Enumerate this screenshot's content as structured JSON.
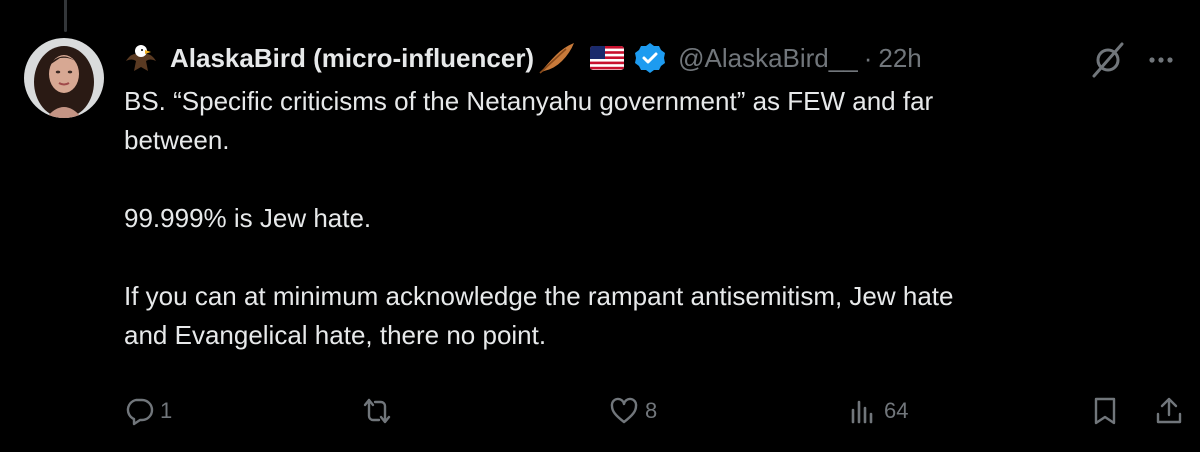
{
  "author": {
    "display_name": "AlaskaBird (micro-influencer)",
    "handle": "@AlaskaBird__",
    "separator": "·",
    "time": "22h",
    "verified": true
  },
  "tweet": {
    "text": "BS. “Specific criticisms of the Netanyahu government” as FEW and far\nbetween.\n\n99.999% is Jew hate.\n\nIf you can at minimum acknowledge the rampant antisemitism, Jew hate\nand Evangelical hate, there no point."
  },
  "actions": {
    "replies": "1",
    "reposts": "",
    "likes": "8",
    "views": "64"
  },
  "icons": {
    "header": [
      "eagle-emoji-icon",
      "feather-emoji-icon",
      "us-flag-icon",
      "verified-badge-icon",
      "grok-icon",
      "more-icon"
    ],
    "actions": [
      "reply-icon",
      "repost-icon",
      "like-icon",
      "views-icon",
      "bookmark-icon",
      "share-icon"
    ]
  },
  "colors": {
    "background": "#000000",
    "text": "#e7e9ea",
    "muted": "#71767b",
    "verified": "#1d9bf0",
    "thread_line": "#333639"
  }
}
